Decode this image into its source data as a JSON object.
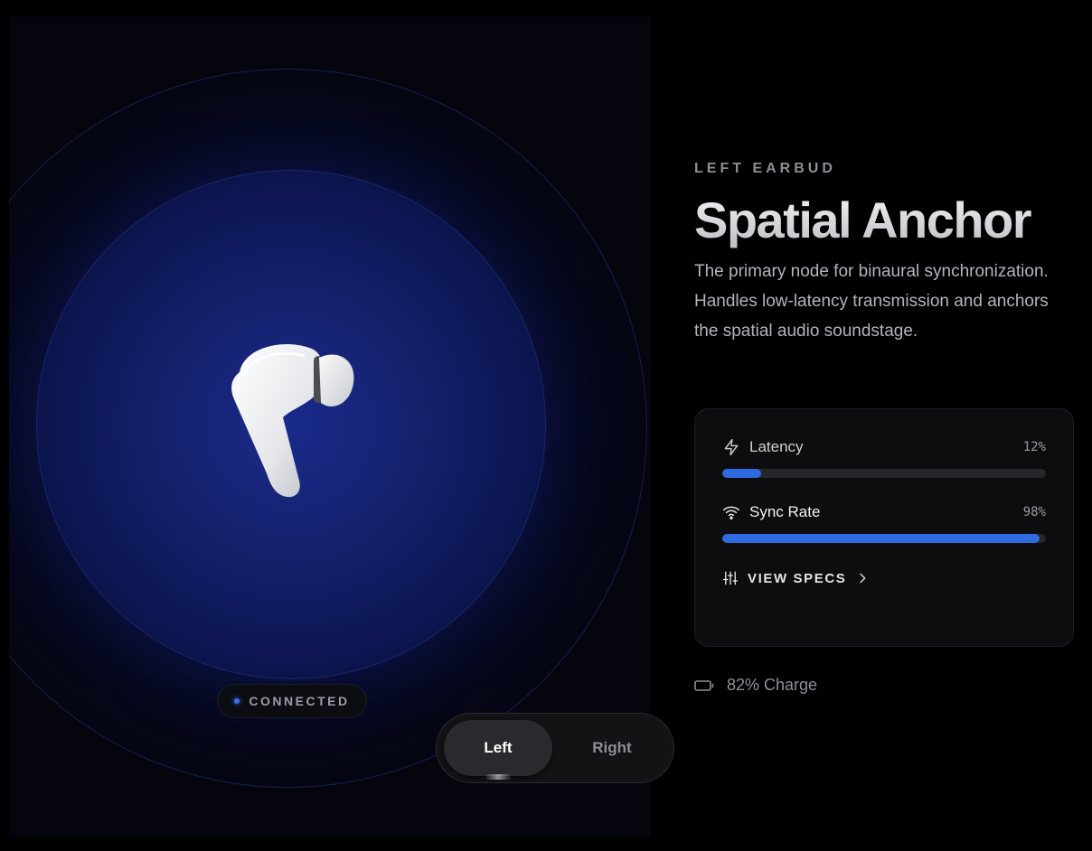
{
  "stage": {
    "status_label": "CONNECTED",
    "accent_color": "#3a6df0"
  },
  "toggle": {
    "options": [
      {
        "label": "Left",
        "active": true
      },
      {
        "label": "Right",
        "active": false
      }
    ]
  },
  "panel": {
    "eyebrow": "LEFT EARBUD",
    "title": "Spatial Anchor",
    "description": "The primary node for binaural synchronization. Handles low-latency transmission and anchors the spatial audio soundstage."
  },
  "metrics": [
    {
      "label": "Latency",
      "value": "12%",
      "fill": 0.12,
      "icon": "lightning-icon"
    },
    {
      "label": "Sync Rate",
      "value": "98%",
      "fill": 0.98,
      "icon": "wifi-icon"
    }
  ],
  "specs": {
    "label": "VIEW SPECS",
    "icon": "sliders-icon"
  },
  "battery": {
    "label": "82% Charge",
    "icon": "battery-icon"
  }
}
